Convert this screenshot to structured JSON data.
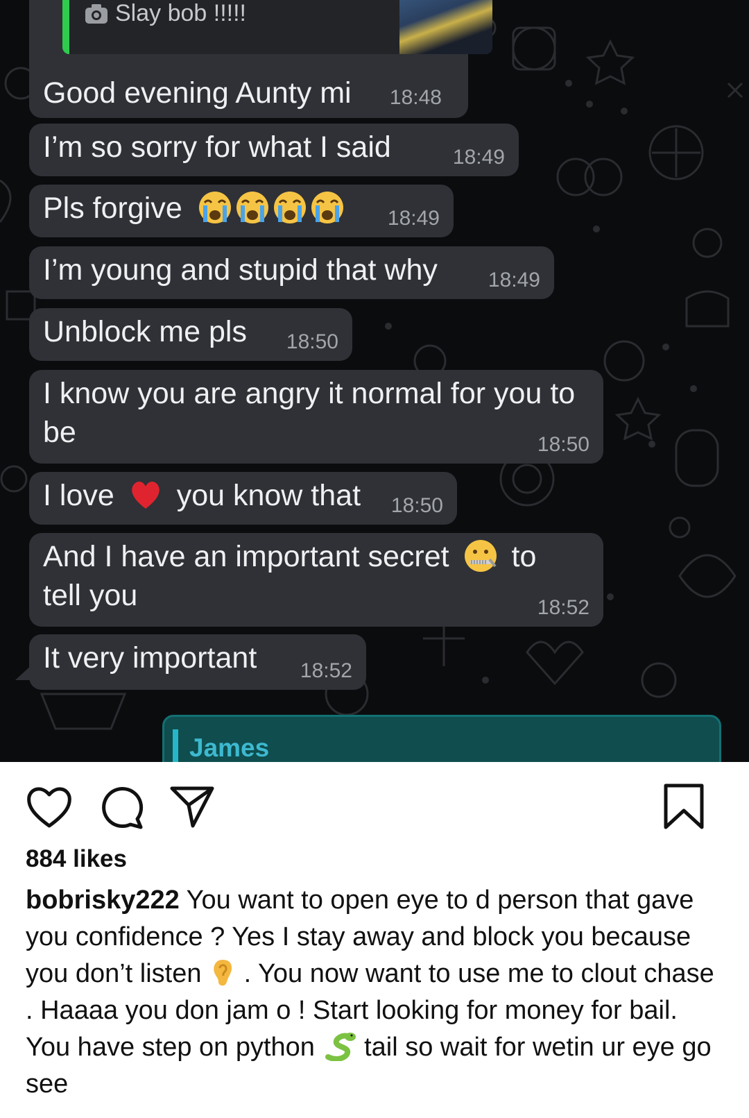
{
  "chat": {
    "quote": {
      "text": "Slay bob !!!!!",
      "icon": "camera-icon"
    },
    "messages": [
      {
        "text": "Good evening Aunty mi",
        "time": "18:48"
      },
      {
        "text": "I’m so sorry for what I said",
        "time": "18:49"
      },
      {
        "text": "Pls forgive",
        "time": "18:49",
        "emoji": "crying-face x4"
      },
      {
        "text": "I’m young and stupid that why",
        "time": "18:49"
      },
      {
        "text": "Unblock me pls",
        "time": "18:50"
      },
      {
        "text": "I know you are angry it normal for you to be",
        "time": "18:50"
      },
      {
        "text_before": "I love",
        "text_after": "you know that",
        "time": "18:50",
        "emoji": "red-heart"
      },
      {
        "text_before": "And I have an important secret",
        "text_after": "to tell you",
        "time": "18:52",
        "emoji": "zipper-mouth-face"
      },
      {
        "text": "It very important",
        "time": "18:52"
      }
    ],
    "outgoing_reply_name": "James"
  },
  "post": {
    "likes": "884 likes",
    "username": "bobrisky222",
    "caption_parts": [
      "You want to open eye to d person that gave  you confidence ? Yes I stay away and block you because you don’t listen",
      ". You now want to use me to clout chase . Haaaa you don jam o ! Start looking for money for bail.  You have step on python",
      "tail so wait for wetin ur eye go see"
    ],
    "caption_emojis": [
      "ear",
      "snake"
    ]
  },
  "colors": {
    "chat_background": "#0b0c0e",
    "bubble": "#2f3136",
    "quote_accent": "#2fcb4e",
    "reply_accent": "#3db9cf"
  }
}
